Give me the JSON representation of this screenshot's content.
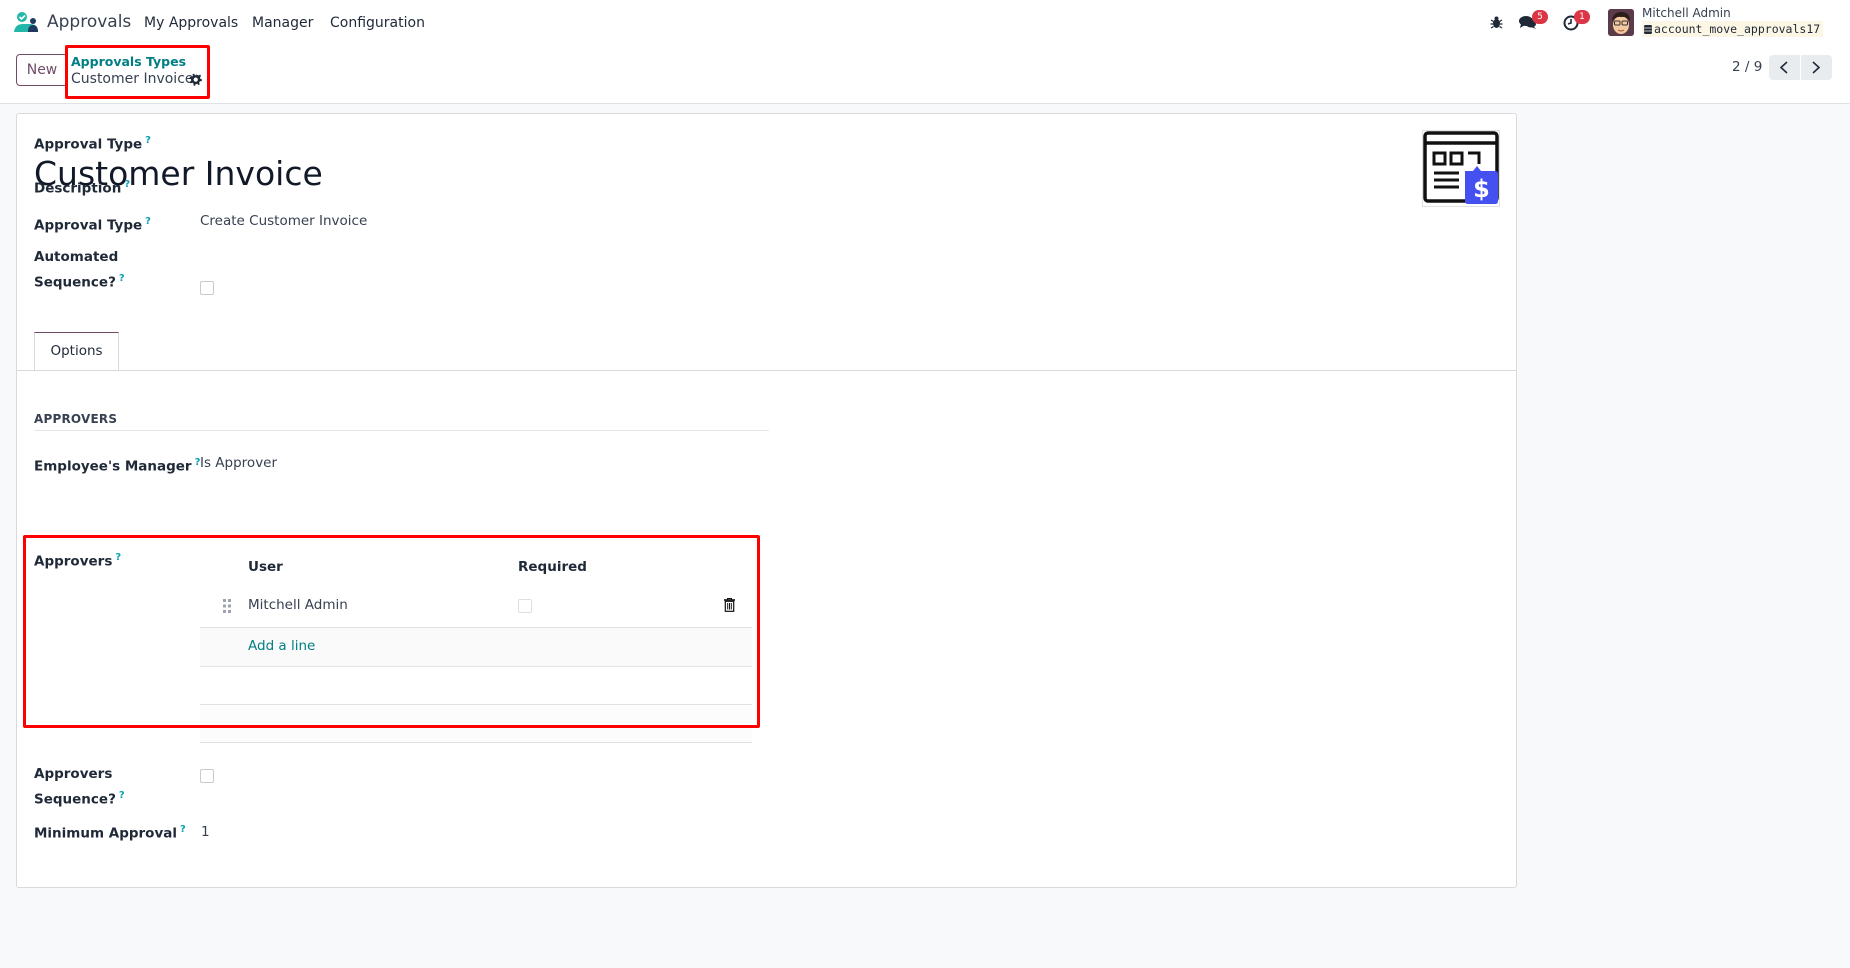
{
  "navbar": {
    "app_name": "Approvals",
    "menu": [
      "My Approvals",
      "Manager",
      "Configuration"
    ],
    "icons": [
      "bug-icon",
      "chat-icon",
      "activity-clock-icon"
    ],
    "messages_badge": "5",
    "activities_badge": "1",
    "user_name": "Mitchell Admin",
    "database": "account_move_approvals17"
  },
  "control": {
    "new_label": "New",
    "breadcrumb_parent": "Approvals Types",
    "breadcrumb_current": "Customer Invoice",
    "pager": "2 / 9"
  },
  "form": {
    "name_label": "Approval Type",
    "name": "Customer Invoice",
    "description_label": "Description",
    "approval_type_label": "Approval Type",
    "approval_type_value": "Create Customer Invoice",
    "automated_sequence_label_1": "Automated",
    "automated_sequence_label_2": "Sequence?",
    "automated_sequence": false,
    "help_mark": "?",
    "tabs": [
      "Options"
    ],
    "approvers_section": "APPROVERS",
    "manager_label": "Employee's Manager",
    "manager_value": "Is Approver",
    "approvers_label": "Approvers",
    "approvers_table": {
      "columns": [
        "User",
        "Required"
      ],
      "rows": [
        {
          "user": "Mitchell Admin",
          "required": false
        }
      ],
      "add_line": "Add a line"
    },
    "approvers_sequence_label_1": "Approvers",
    "approvers_sequence_label_2": "Sequence?",
    "approvers_sequence": false,
    "min_approval_label": "Minimum Approval",
    "min_approval_value": "1"
  },
  "colors": {
    "brand": "#714b67",
    "link": "#017e84",
    "badge": "#dc3545",
    "highlight": "#ff0000",
    "image_accent": "#4450f0"
  }
}
